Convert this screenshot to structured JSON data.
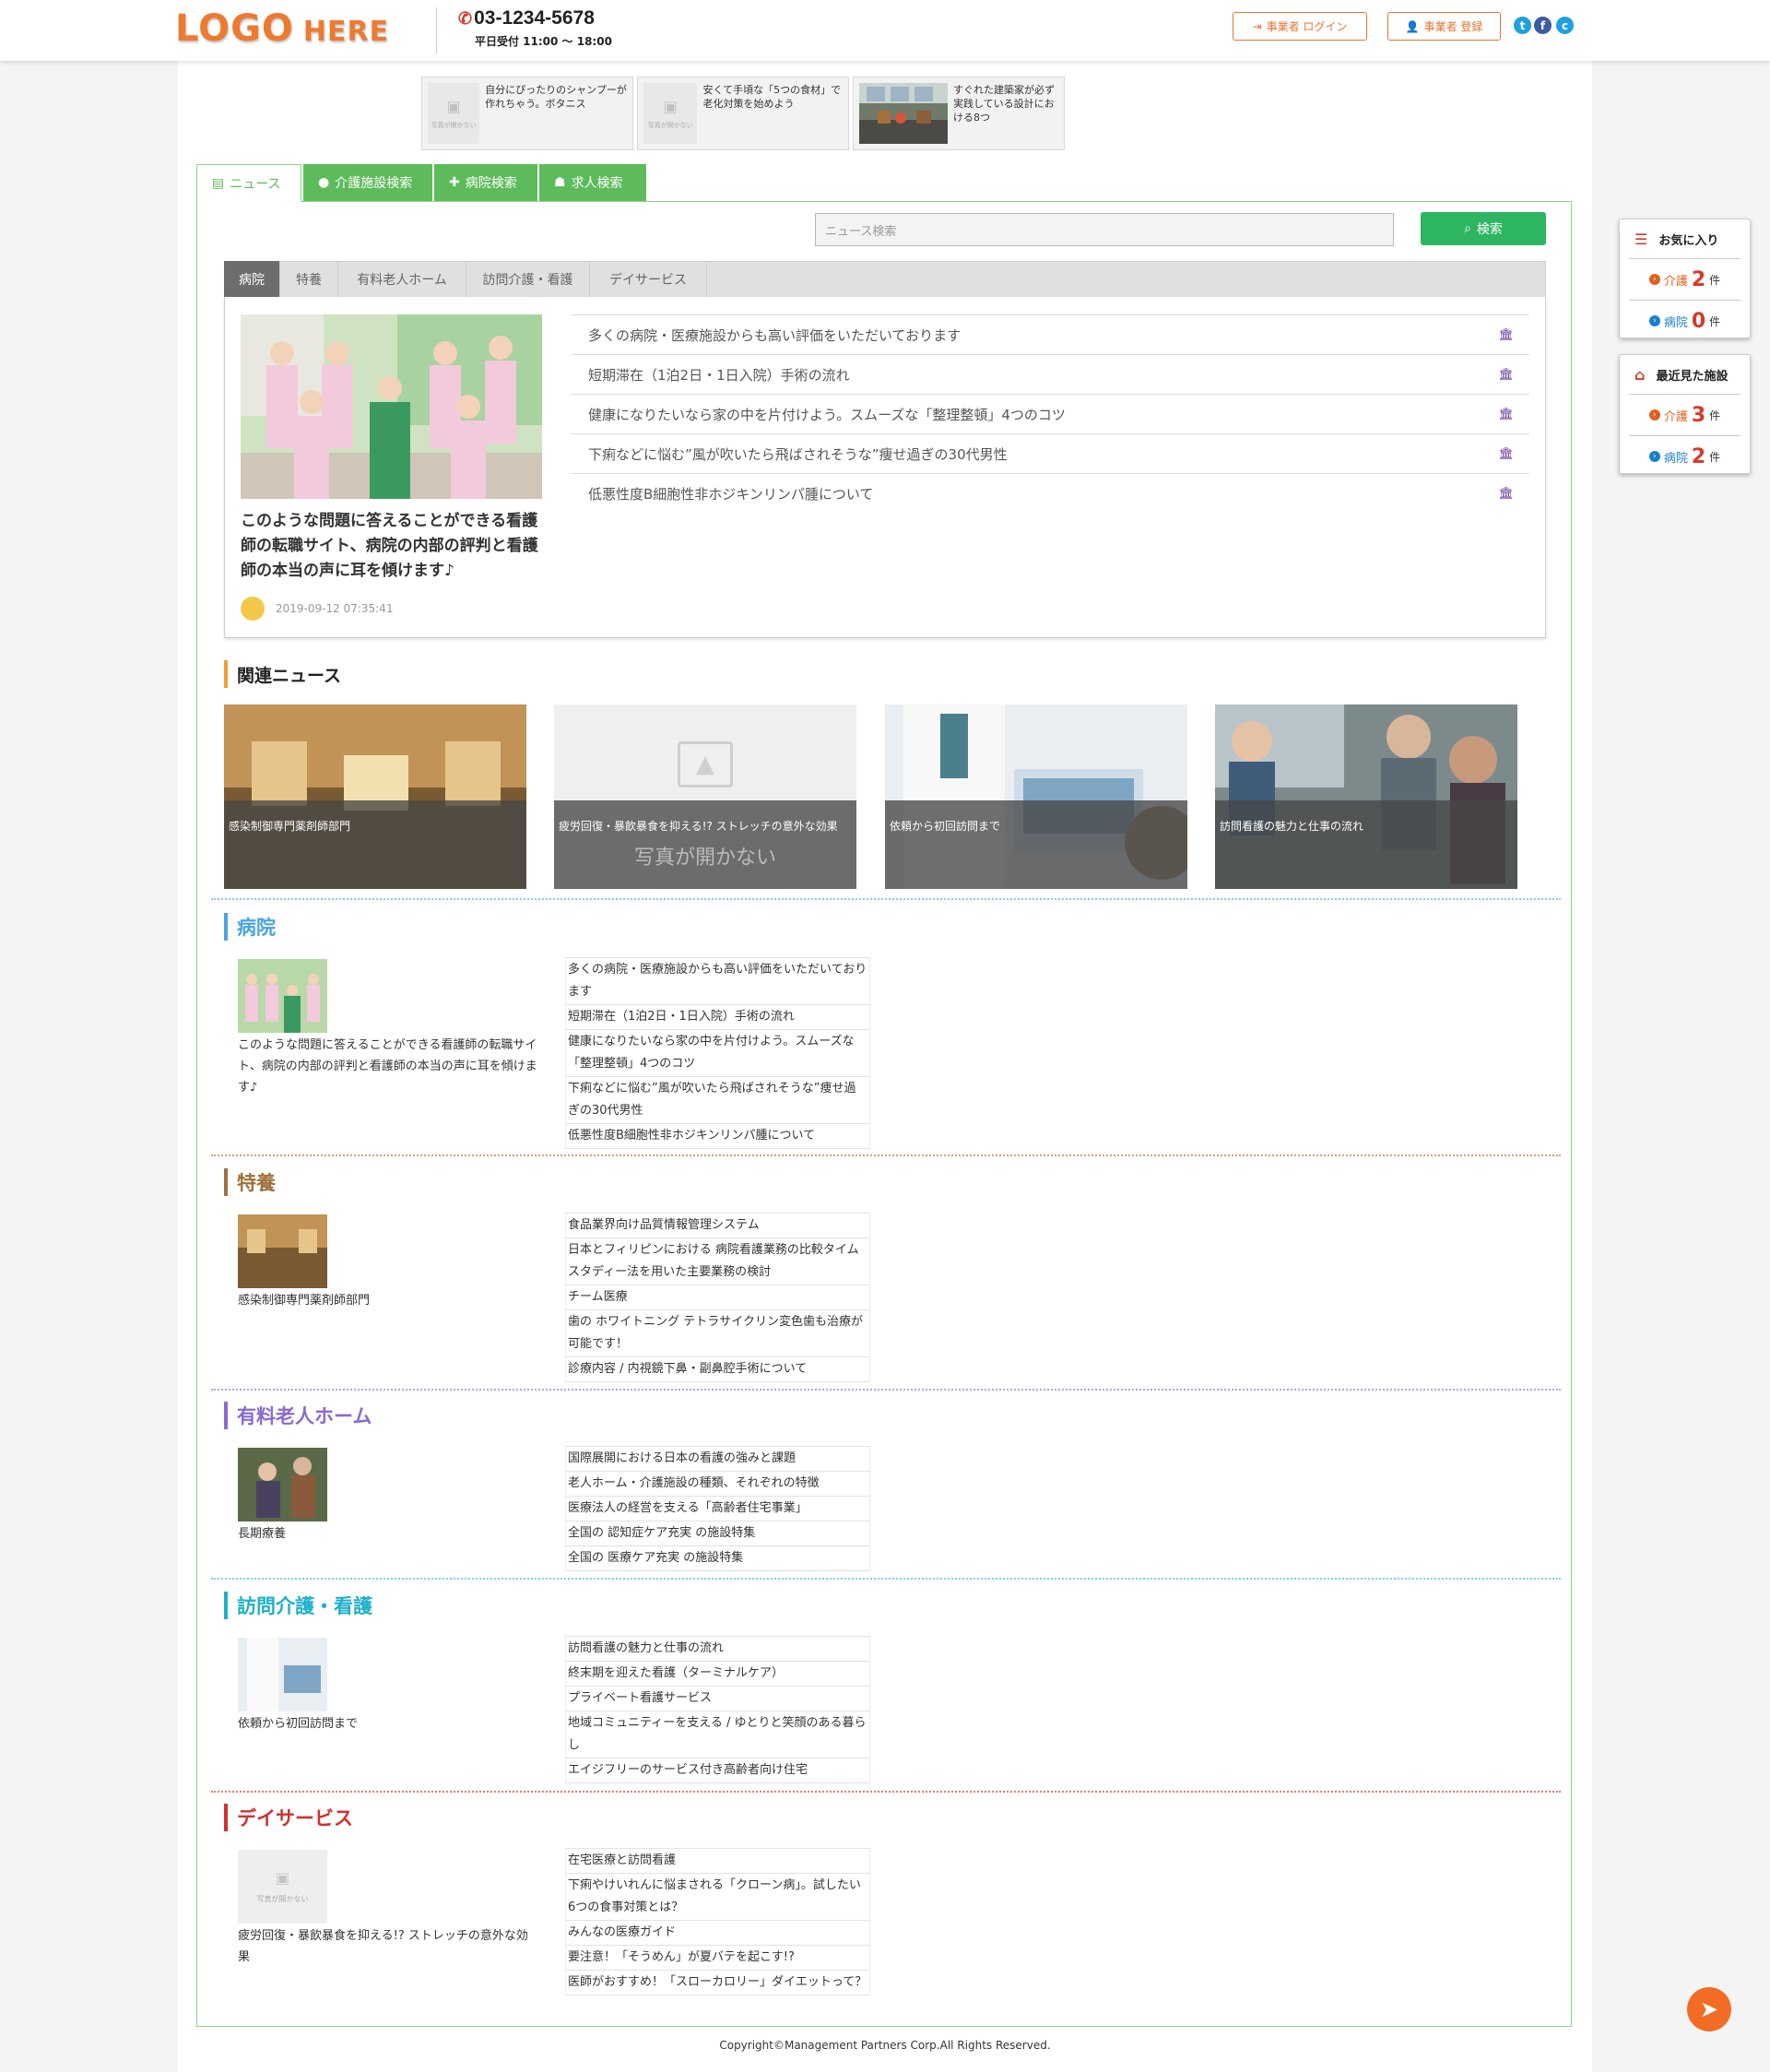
{
  "header": {
    "logo_main": "LOGO",
    "logo_sub": "HERE",
    "phone": "03-1234-5678",
    "hours": "平日受付 11:00 ～ 18:00",
    "login_label": "事業者 ログイン",
    "register_label": "事業者 登録"
  },
  "top_thumbs": [
    {
      "text": "自分にぴったりのシャンプーが作れちゃう。ボタニス",
      "placeholder": "写真が開かない"
    },
    {
      "text": "安くて手頃な「5つの食材」で老化対策を始めよう",
      "placeholder": "写真が開かない"
    },
    {
      "text": "すぐれた建築家が必ず実践している設計における8つ"
    }
  ],
  "main_tabs": [
    "ニュース",
    "介護施設検索",
    "病院検索",
    "求人検索"
  ],
  "search": {
    "placeholder": "ニュース検索",
    "button": "検索"
  },
  "category_tabs": [
    "病院",
    "特養",
    "有料老人ホーム",
    "訪問介護・看護",
    "デイサービス"
  ],
  "featured": {
    "title": "このような問題に答えることができる看護師の転職サイト、病院の内部の評判と看護師の本当の声に耳を傾けます♪",
    "date": "2019-09-12 07:35:41"
  },
  "news_list": [
    "多くの病院・医療施設からも高い評価をいただいております",
    "短期滞在（1泊2日・1日入院）手術の流れ",
    "健康になりたいなら家の中を片付けよう。スムーズな「整理整頓」4つのコツ",
    "下痢などに悩む”風が吹いたら飛ばされそうな”痩せ過ぎの30代男性",
    "低悪性度B細胞性非ホジキンリンパ腫について"
  ],
  "related": {
    "heading": "関連ニュース",
    "items": [
      {
        "caption": "感染制御専門薬剤師部門"
      },
      {
        "caption": "疲労回復・暴飲暴食を抑える!? ストレッチの意外な効果",
        "placeholder": "写真が開かない"
      },
      {
        "caption": "依頼から初回訪問まで"
      },
      {
        "caption": "訪問看護の魅力と仕事の流れ"
      }
    ]
  },
  "sections": [
    {
      "title": "病院",
      "color": "#4aa3df",
      "caption": "このような問題に答えることができる看護師の転職サイト、病院の内部の評判と看護師の本当の声に耳を傾けます♪",
      "items": [
        "多くの病院・医療施設からも高い評価をいただいております",
        "短期滞在（1泊2日・1日入院）手術の流れ",
        "健康になりたいなら家の中を片付けよう。スムーズな「整理整頓」4つのコツ",
        "下痢などに悩む”風が吹いたら飛ばされそうな”痩せ過ぎの30代男性",
        "低悪性度B細胞性非ホジキンリンパ腫について"
      ]
    },
    {
      "title": "特養",
      "color": "#a0703a",
      "caption": "感染制御専門薬剤師部門",
      "items": [
        "食品業界向け品質情報管理システム",
        "日本とフィリピンにおける 病院看護業務の比較タイムスタディー法を用いた主要業務の検討",
        "チーム医療",
        "歯の ホワイトニング テトラサイクリン変色歯も治療が可能です！",
        "診療内容 / 内視鏡下鼻・副鼻腔手術について"
      ]
    },
    {
      "title": "有料老人ホーム",
      "color": "#8a6ad0",
      "caption": "長期療養",
      "items": [
        "国際展開における日本の看護の強みと課題",
        "老人ホーム・介護施設の種類、それぞれの特徴",
        "医療法人の経営を支える「高齢者住宅事業」",
        "全国の 認知症ケア充実 の施設特集",
        "全国の 医療ケア充実 の施設特集"
      ]
    },
    {
      "title": "訪問介護・看護",
      "color": "#1fb0c8",
      "caption": "依頼から初回訪問まで",
      "items": [
        "訪問看護の魅力と仕事の流れ",
        "終末期を迎えた看護（ターミナルケア）",
        "プライベート看護サービス",
        "地域コミュニティーを支える / ゆとりと笑顔のある暮らし",
        "エイジフリーのサービス付き高齢者向け住宅"
      ]
    },
    {
      "title": "デイサービス",
      "color": "#d03030",
      "caption": "疲労回復・暴飲暴食を抑える!? ストレッチの意外な効果",
      "placeholder": "写真が開かない",
      "items": [
        "在宅医療と訪問看護",
        "下痢やけいれんに悩まされる「クローン病」。試したい6つの食事対策とは？",
        "みんなの医療ガイド",
        "要注意！「そうめん」が夏バテを起こす!?",
        "医師がおすすめ！「スローカロリー」ダイエットって？"
      ]
    }
  ],
  "sidebar": {
    "favorites": {
      "title": "お気に入り",
      "care_label": "介護",
      "care_count": "2",
      "hosp_label": "病院",
      "hosp_count": "0",
      "unit": "件"
    },
    "recent": {
      "title": "最近見た施設",
      "care_label": "介護",
      "care_count": "3",
      "hosp_label": "病院",
      "hosp_count": "2",
      "unit": "件"
    }
  },
  "footer": "Copyright©Management Partners Corp.All Rights Reserved.",
  "colors": {
    "green": "#5ebb5b",
    "orange": "#ee7a30",
    "search_green": "#2db562"
  }
}
